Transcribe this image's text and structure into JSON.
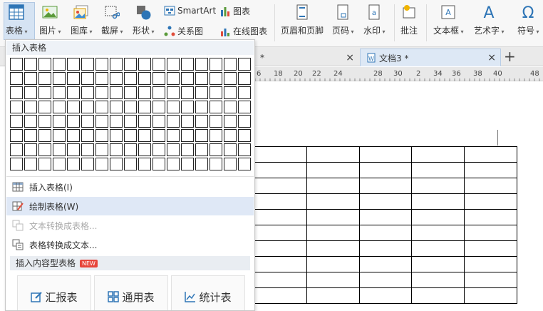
{
  "ribbon": {
    "table_label": "表格",
    "picture_label": "图片",
    "gallery_label": "图库",
    "screenshot_label": "截屏",
    "shape_label": "形状",
    "smartart_label": "SmartArt",
    "chart_label": "图表",
    "relation_label": "关系图",
    "online_chart_label": "在线图表",
    "header_footer_label": "页眉和页脚",
    "page_number_label": "页码",
    "watermark_label": "水印",
    "comment_label": "批注",
    "textbox_label": "文本框",
    "wordart_label": "艺术字",
    "symbol_label": "符号",
    "accent_color": "#2e75b6"
  },
  "tabs": [
    {
      "label": "*"
    },
    {
      "label": "文档3 *"
    }
  ],
  "ruler": {
    "numbers": [
      "6",
      "18",
      "20",
      "22",
      "24",
      "28",
      "30",
      "2",
      "34",
      "36",
      "38",
      "40",
      "48"
    ]
  },
  "dropdown": {
    "header": "插入表格",
    "grid_rows": 8,
    "grid_cols": 17,
    "items": [
      {
        "label": "插入表格(I)",
        "icon": "table-insert-icon",
        "state": "normal"
      },
      {
        "label": "绘制表格(W)",
        "icon": "pencil-table-icon",
        "state": "hover"
      },
      {
        "label": "文本转换成表格...",
        "icon": "text-to-table-icon",
        "state": "disabled"
      },
      {
        "label": "表格转换成文本...",
        "icon": "table-to-text-icon",
        "state": "normal"
      }
    ],
    "content_section_label": "插入内容型表格",
    "new_badge": "NEW",
    "templates": [
      {
        "label": "汇报表",
        "icon": "edit-icon"
      },
      {
        "label": "通用表",
        "icon": "grid-icon"
      },
      {
        "label": "统计表",
        "icon": "line-chart-icon"
      }
    ]
  },
  "doc_table": {
    "rows": 10,
    "cols": 5
  }
}
